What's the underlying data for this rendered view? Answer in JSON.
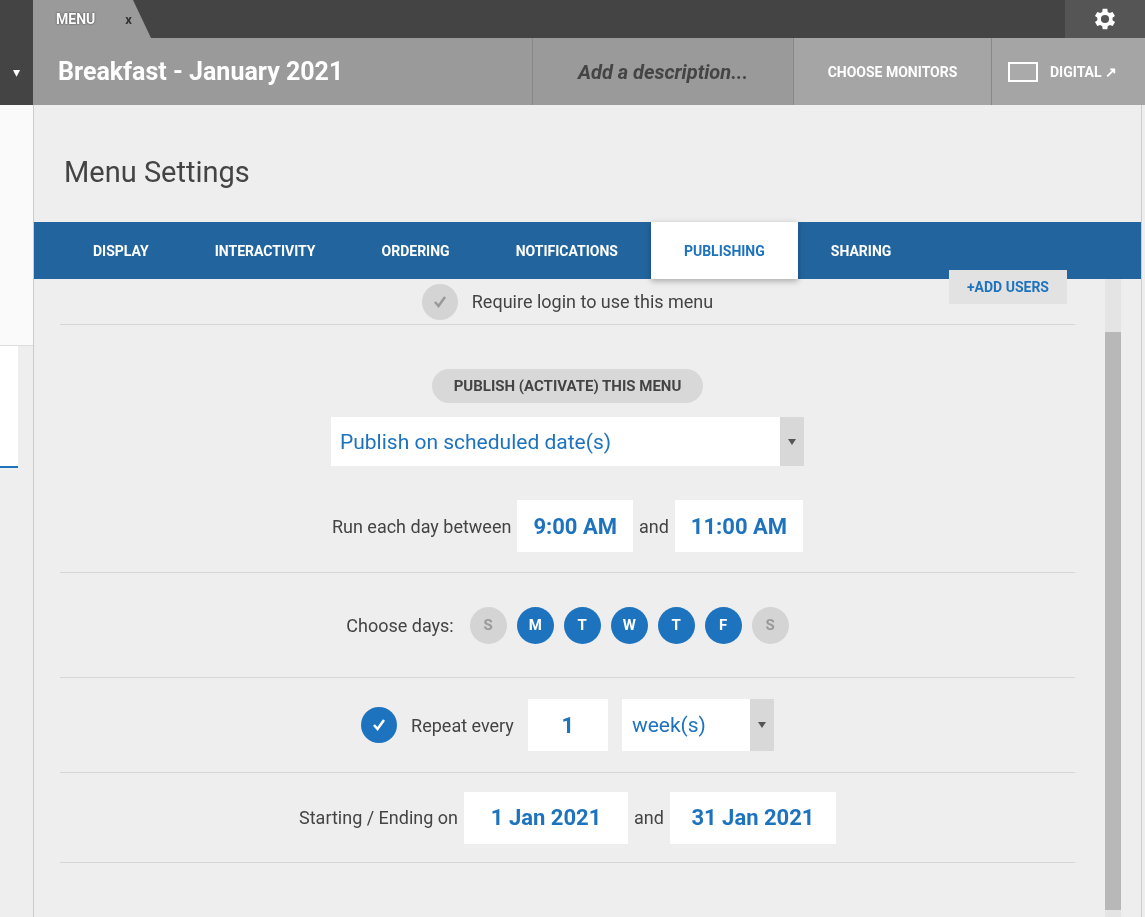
{
  "top_tab": {
    "label": "MENU",
    "close": "x"
  },
  "header": {
    "title": "Breakfast - January 2021",
    "caret": "▾",
    "description_placeholder": "Add a description...",
    "choose_monitors": "CHOOSE MONITORS",
    "digital": "DIGITAL ↗"
  },
  "panel_title": "Menu Settings",
  "tabs": [
    {
      "label": "DISPLAY",
      "selected": false
    },
    {
      "label": "INTERACTIVITY",
      "selected": false
    },
    {
      "label": "ORDERING",
      "selected": false
    },
    {
      "label": "NOTIFICATIONS",
      "selected": false
    },
    {
      "label": "PUBLISHING",
      "selected": true
    },
    {
      "label": "SHARING",
      "selected": false
    }
  ],
  "require_login": {
    "label": "Require login to use this menu",
    "checked": false,
    "add_users": "+ADD USERS"
  },
  "publish": {
    "heading": "PUBLISH (ACTIVATE) THIS MENU",
    "mode": "Publish on scheduled date(s)"
  },
  "run_each_day": {
    "label": "Run each day between",
    "start": "9:00 AM",
    "and": "and",
    "end": "11:00 AM"
  },
  "choose_days": {
    "label": "Choose days:",
    "days": [
      {
        "label": "S",
        "selected": false
      },
      {
        "label": "M",
        "selected": true
      },
      {
        "label": "T",
        "selected": true
      },
      {
        "label": "W",
        "selected": true
      },
      {
        "label": "T",
        "selected": true
      },
      {
        "label": "F",
        "selected": true
      },
      {
        "label": "S",
        "selected": false
      }
    ]
  },
  "repeat": {
    "checked": true,
    "label": "Repeat every",
    "count": "1",
    "unit": "week(s)"
  },
  "dates": {
    "label": "Starting / Ending on",
    "start": "1 Jan 2021",
    "and": "and",
    "end": "31 Jan 2021"
  }
}
